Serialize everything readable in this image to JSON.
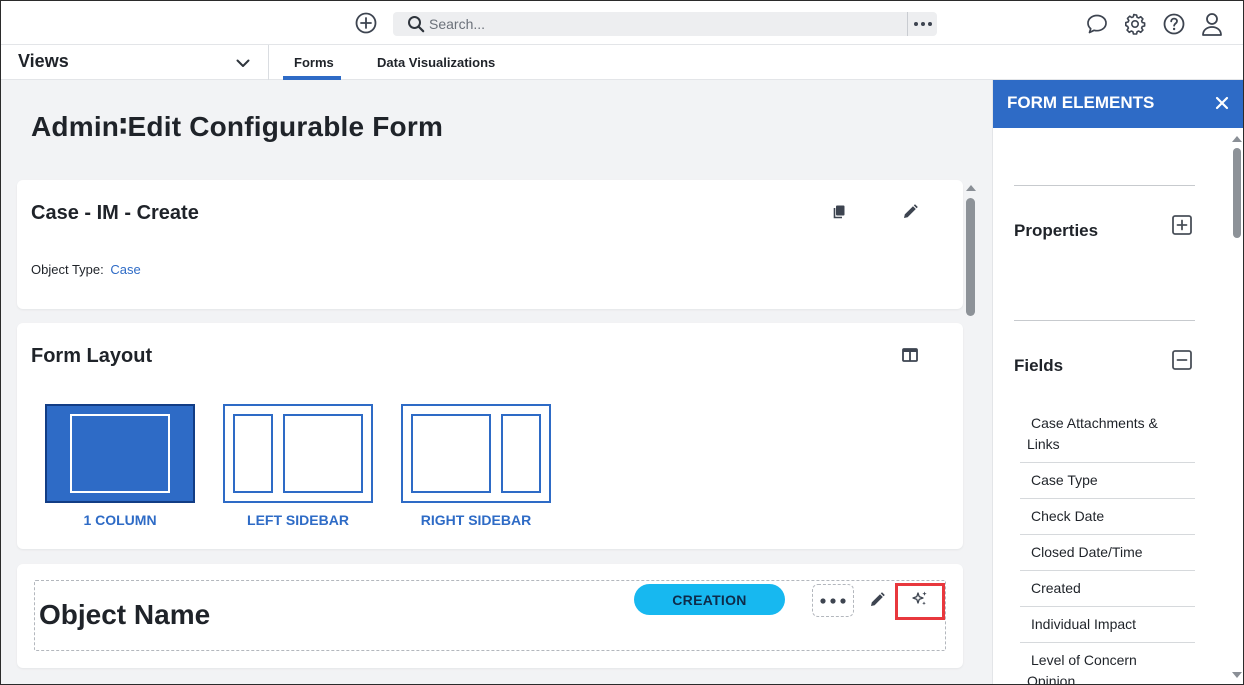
{
  "topbar": {
    "search_placeholder": "Search...",
    "icons": [
      "add-circle-icon",
      "search-icon",
      "more-horizontal-icon",
      "chat-icon",
      "gear-icon",
      "help-icon",
      "user-icon"
    ]
  },
  "navbar": {
    "views_label": "Views",
    "tabs": [
      {
        "label": "Forms",
        "active": true
      },
      {
        "label": "Data Visualizations",
        "active": false
      }
    ]
  },
  "main": {
    "page_title": "Admin∶Edit Configurable Form",
    "form_card": {
      "title": "Case - IM - Create",
      "object_type_label": "Object Type:",
      "object_type_value": "Case"
    },
    "layout_card": {
      "title": "Form Layout",
      "options": [
        {
          "label": "1 COLUMN",
          "selected": true
        },
        {
          "label": "LEFT SIDEBAR",
          "selected": false
        },
        {
          "label": "RIGHT SIDEBAR",
          "selected": false
        }
      ]
    },
    "section_card": {
      "title": "Object Name",
      "badge": "CREATION"
    }
  },
  "panel": {
    "title": "FORM ELEMENTS",
    "properties_title": "Properties",
    "fields_title": "Fields",
    "fields": [
      "Case Attachments & Links",
      "Case Type",
      "Check Date",
      "Closed Date/Time",
      "Created",
      "Individual Impact",
      "Level of Concern Opinion"
    ]
  },
  "colors": {
    "accent": "#2e6bc6",
    "badge": "#17b8f0",
    "highlight": "#e8383d",
    "main_bg": "#f2f3f5"
  }
}
